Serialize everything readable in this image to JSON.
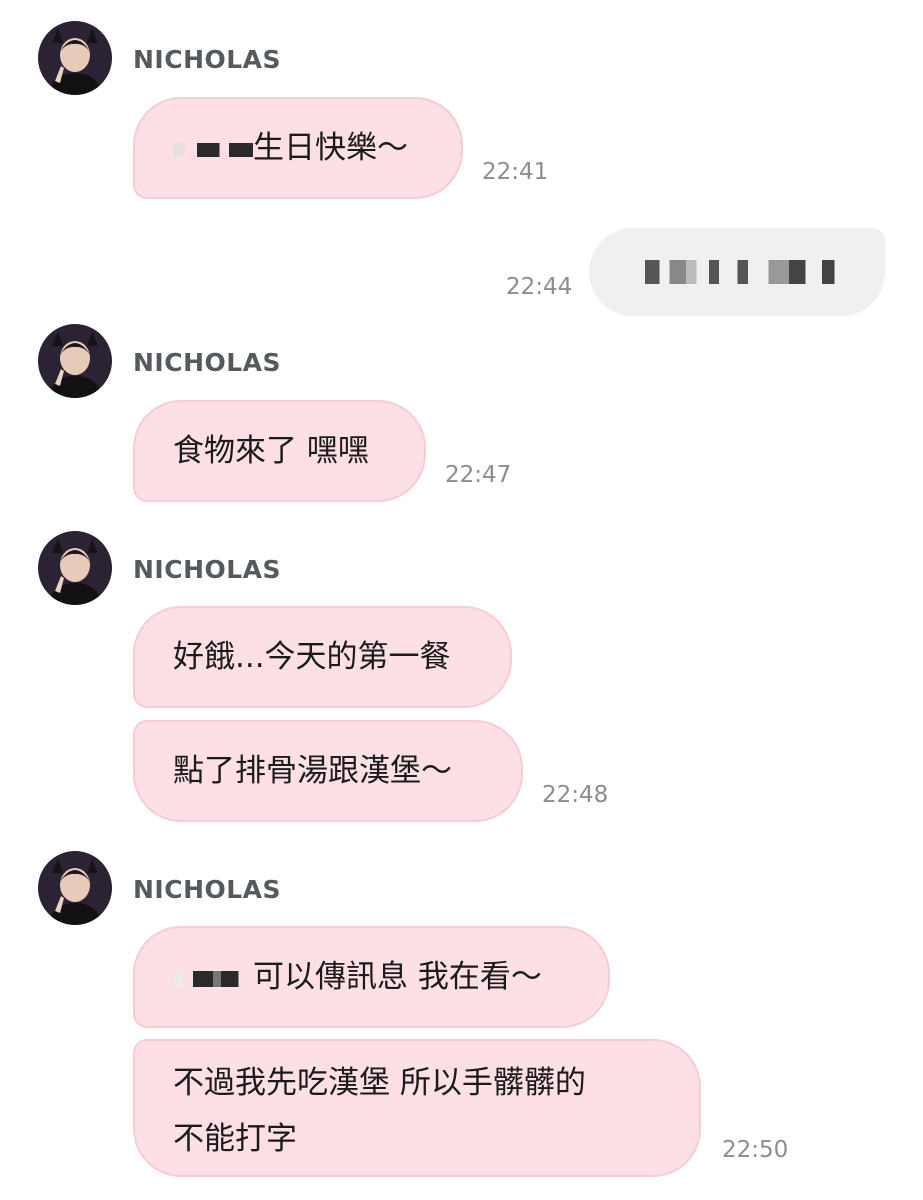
{
  "contact": {
    "name": "NICHOLAS"
  },
  "messages": [
    {
      "from": "NICHOLAS",
      "text": "生日快樂～",
      "time": "22:41",
      "redacted_prefix": true
    },
    {
      "from": "me",
      "text": "",
      "time": "22:44",
      "redacted": true
    },
    {
      "from": "NICHOLAS",
      "text": "食物來了 嘿嘿",
      "time": "22:47"
    },
    {
      "from": "NICHOLAS",
      "text": "好餓...今天的第一餐",
      "time": ""
    },
    {
      "from": "NICHOLAS",
      "text": "點了排骨湯跟漢堡～",
      "time": "22:48"
    },
    {
      "from": "NICHOLAS",
      "text": "可以傳訊息 我在看～",
      "time": "",
      "redacted_prefix": true
    },
    {
      "from": "NICHOLAS",
      "lines": [
        "不過我先吃漢堡 所以手髒髒的",
        "不能打字"
      ],
      "time": "22:50"
    }
  ],
  "colors": {
    "incoming_bubble": "#fde0e5",
    "incoming_border": "#f6cdd4",
    "outgoing_bubble": "#f0f0f3",
    "timestamp": "#8d8d8d",
    "sender_name": "#555a5f"
  },
  "icons": {
    "avatar": "avatar-icon"
  }
}
